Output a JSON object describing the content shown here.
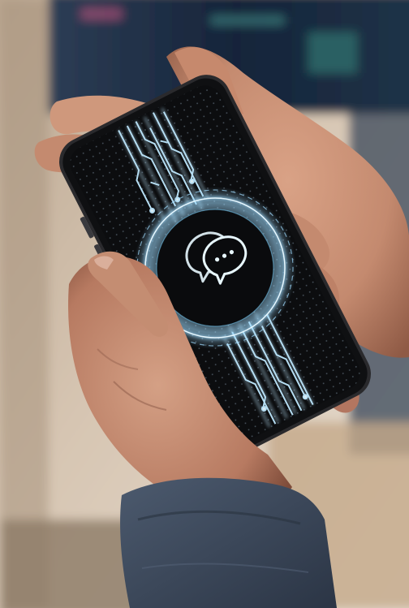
{
  "scene": {
    "description_visible_text": "",
    "colors": {
      "background_warm": "#cdb79f",
      "background_light": "#e9e1d6",
      "monitor_dark": "#16243a",
      "skin_base": "#c98f74",
      "skin_shadow": "#8f5a45",
      "sleeve": "#3d4a5c",
      "phone_body": "#1a1a1c",
      "screen": "#0c0d0f",
      "glow": "#9fdcff",
      "glow_core": "#e8f8ff"
    }
  },
  "phone": {
    "screen_icon": "chat-bubbles-icon",
    "screen_pattern": "circuit-trace-pattern"
  }
}
